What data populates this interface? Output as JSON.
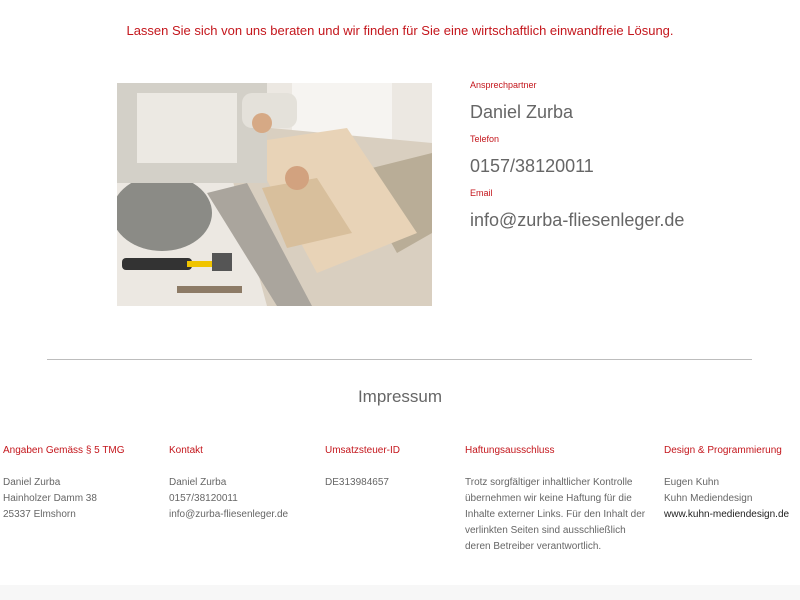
{
  "tagline": "Lassen Sie sich von uns beraten und wir finden für Sie eine wirtschaftlich einwandfreie Lösung.",
  "contact": {
    "name_label": "Ansprechpartner",
    "name": "Daniel Zurba",
    "phone_label": "Telefon",
    "phone": "0157/38120011",
    "email_label": "Email",
    "email": "info@zurba-fliesenleger.de"
  },
  "impressum": {
    "title": "Impressum",
    "angaben": {
      "heading": "Angaben Gemäss § 5 TMG",
      "lines": [
        "Daniel Zurba",
        "Hainholzer Damm 38",
        "25337 Elmshorn"
      ]
    },
    "kontakt": {
      "heading": "Kontakt",
      "lines": [
        "Daniel Zurba",
        "0157/38120011",
        "info@zurba-fliesenleger.de"
      ]
    },
    "ust": {
      "heading": "Umsatzsteuer-ID",
      "lines": [
        "DE313984657"
      ]
    },
    "haftung": {
      "heading": "Haftungsausschluss",
      "lines": [
        "Trotz sorgfältiger inhaltlicher Kontrolle",
        "übernehmen wir keine Haftung für die",
        "Inhalte externer Links. Für den Inhalt der",
        "verlinkten Seiten sind ausschließlich",
        "deren Betreiber verantwortlich."
      ]
    },
    "design": {
      "heading": "Design & Programmierung",
      "lines": [
        "Eugen Kuhn",
        "Kuhn Mediendesign",
        "www.kuhn-mediendesign.de"
      ]
    }
  },
  "colors": {
    "accent": "#c4161c",
    "text": "#666666",
    "divider": "#bdbdbd"
  }
}
